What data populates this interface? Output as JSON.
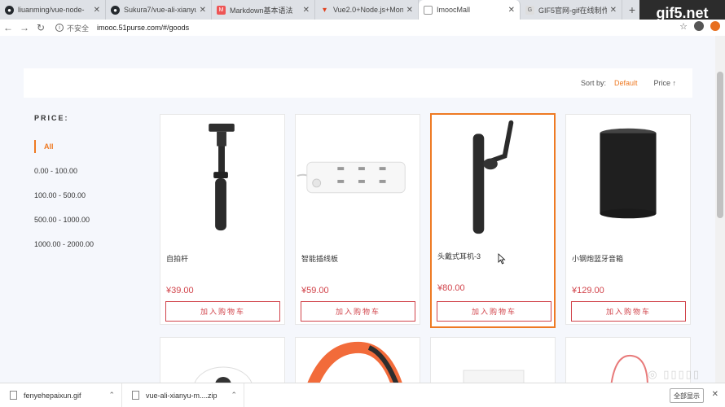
{
  "browser": {
    "tabs": [
      {
        "title": "liuanming/vue-node-",
        "icon": "github-icon"
      },
      {
        "title": "Sukura7/vue-ali-xianyu",
        "icon": "github-icon"
      },
      {
        "title": "Markdown基本语法",
        "icon": "markdown-icon"
      },
      {
        "title": "Vue2.0+Node.js+Mon",
        "icon": "vuejs-icon"
      },
      {
        "title": "ImoocMall",
        "icon": "page-icon"
      },
      {
        "title": "GIF5官网-gif在线制作_",
        "icon": "gif5-icon"
      }
    ],
    "active_tab": 4,
    "insecure_label": "不安全",
    "url": "imooc.51purse.com/#/goods",
    "watermark": "gif5.net"
  },
  "sortbar": {
    "label": "Sort by:",
    "default": "Default",
    "price": "Price ↑"
  },
  "filter": {
    "title": "PRICE:",
    "items": [
      "All",
      "0.00 - 100.00",
      "100.00 - 500.00",
      "500.00 - 1000.00",
      "1000.00 - 2000.00"
    ],
    "active": 0
  },
  "products": [
    {
      "name": "自拍杆",
      "price": "¥39.00",
      "button": "加入购物车",
      "image": "selfie-stick"
    },
    {
      "name": "智能插线板",
      "price": "¥59.00",
      "button": "加入购物车",
      "image": "power-strip"
    },
    {
      "name": "头戴式耳机-3",
      "price": "¥80.00",
      "button": "加入购物车",
      "image": "bluetooth-headset"
    },
    {
      "name": "小钢炮蓝牙音箱",
      "price": "¥129.00",
      "button": "加入购物车",
      "image": "bluetooth-speaker"
    }
  ],
  "downloads": [
    {
      "name": "fenyehepaixun.gif"
    },
    {
      "name": "vue-ali-xianyu-m....zip"
    }
  ],
  "show_all": "全部显示",
  "colors": {
    "accent": "#ee7a23",
    "price": "#d1434a"
  }
}
